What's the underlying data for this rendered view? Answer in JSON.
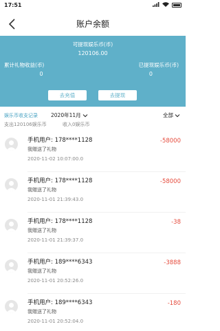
{
  "status": {
    "time": "17:51",
    "battery": "100"
  },
  "nav": {
    "title": "账户余额"
  },
  "hero": {
    "withdrawable_label": "可提现娱乐币(币)",
    "withdrawable_value": "120106.00",
    "gift_income_label": "累计礼物收益(币)",
    "gift_income_value": "0",
    "withdrawn_label": "已提现娱乐币(币)",
    "withdrawn_value": "0",
    "recharge_label": "去充值",
    "withdraw_label": "去提现"
  },
  "filter": {
    "records_title": "娱乐币收支记录",
    "month": "2020年11月",
    "all": "全部",
    "summary_out": "支出120106娱乐币",
    "summary_in": "收入0娱乐币"
  },
  "records": [
    {
      "user": "手机用户: 178****1128",
      "desc": "我赠送了礼物",
      "time": "2020-11-02 10:07:00.0",
      "amount": "-58000"
    },
    {
      "user": "手机用户: 178****1128",
      "desc": "我赠送了礼物",
      "time": "2020-11-01 21:39:43.0",
      "amount": "-58000"
    },
    {
      "user": "手机用户: 178****1128",
      "desc": "我赠送了礼物",
      "time": "2020-11-01 21:39:37.0",
      "amount": "-38"
    },
    {
      "user": "手机用户: 189****6343",
      "desc": "我赠送了礼物",
      "time": "2020-11-01 20:52:26.0",
      "amount": "-3888"
    },
    {
      "user": "手机用户: 189****6343",
      "desc": "我赠送了礼物",
      "time": "2020-11-01 20:52:04.0",
      "amount": "-180"
    }
  ],
  "colors": {
    "accent": "#5fb0c9",
    "amount": "#e54b3c",
    "link": "#4aa3c3"
  }
}
